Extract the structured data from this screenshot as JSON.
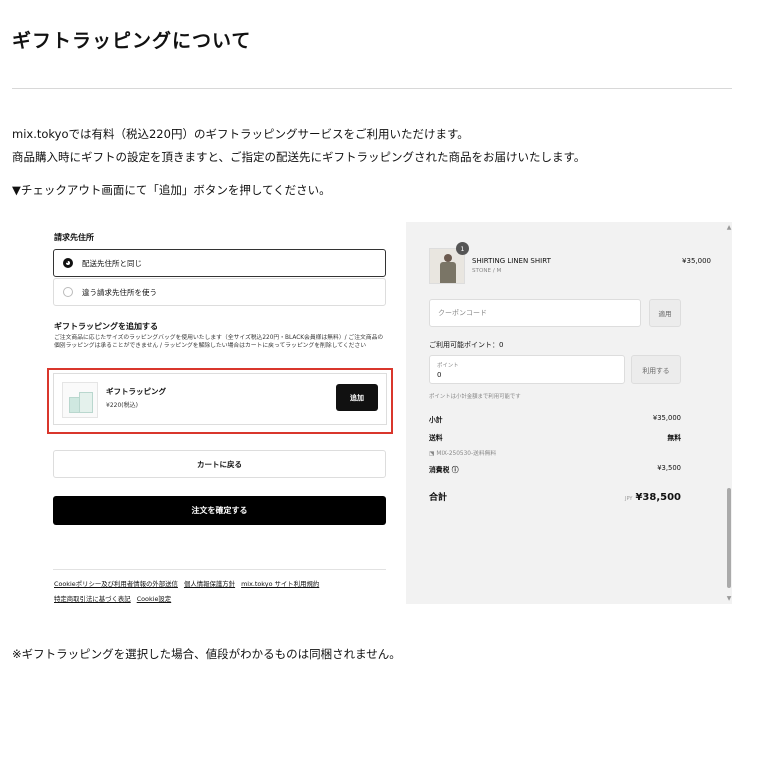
{
  "page": {
    "title": "ギフトラッピングについて",
    "intro_line1": "mix.tokyoでは有料（税込220円）のギフトラッピングサービスをご利用いただけます。",
    "intro_line2": "商品購入時にギフトの設定を頂きますと、ご指定の配送先にギフトラッピングされた商品をお届けいたします。",
    "instruction": "▼チェックアウト画面にて「追加」ボタンを押してください。",
    "footnote": "※ギフトラッピングを選択した場合、値段がわかるものは同梱されません。"
  },
  "checkout": {
    "billing": {
      "section_label": "請求先住所",
      "option_same": "配送先住所と同じ",
      "option_different": "違う請求先住所を使う"
    },
    "gift": {
      "section_label": "ギフトラッピングを追加する",
      "description": "ご注文商品に応じたサイズのラッピングバッグを使用いたします（全サイズ税込220円・BLACK会員様は無料）/ ご注文商品の個別ラッピングは承ることができません / ラッピングを解除したい場合はカートに戻ってラッピングを削除してください",
      "item_name": "ギフトラッピング",
      "item_price": "¥220(税込)",
      "add_label": "追加"
    },
    "back_label": "カートに戻る",
    "confirm_label": "注文を確定する",
    "footer_links_row1": [
      "Cookieポリシー及び利用者情報の外部送信",
      "個人情報保護方針",
      "mix.tokyo サイト利用規約"
    ],
    "footer_links_row2": [
      "特定商取引法に基づく表記",
      "Cookie設定"
    ]
  },
  "summary": {
    "quantity": "1",
    "product_name": "SHIRTING LINEN SHIRT",
    "product_variant": "STONE / M",
    "product_price": "¥35,000",
    "coupon_placeholder": "クーポンコード",
    "apply_label": "適用",
    "points_label": "ご利用可能ポイント：0",
    "points_placeholder": "ポイント",
    "points_value": "0",
    "use_label": "利用する",
    "points_note": "ポイントは小計金額まで利用可能です",
    "subtotal_label": "小計",
    "subtotal_value": "¥35,000",
    "shipping_label": "送料",
    "shipping_value": "無料",
    "shipping_code": "MIX-250530-送料無料",
    "tax_label": "消費税 ⓘ",
    "tax_value": "¥3,500",
    "total_label": "合計",
    "total_currency": "JPY",
    "total_value": "¥38,500"
  },
  "colors": {
    "highlight": "#d9362c",
    "primary_button": "#000000",
    "summary_bg": "#f2f2f2"
  }
}
